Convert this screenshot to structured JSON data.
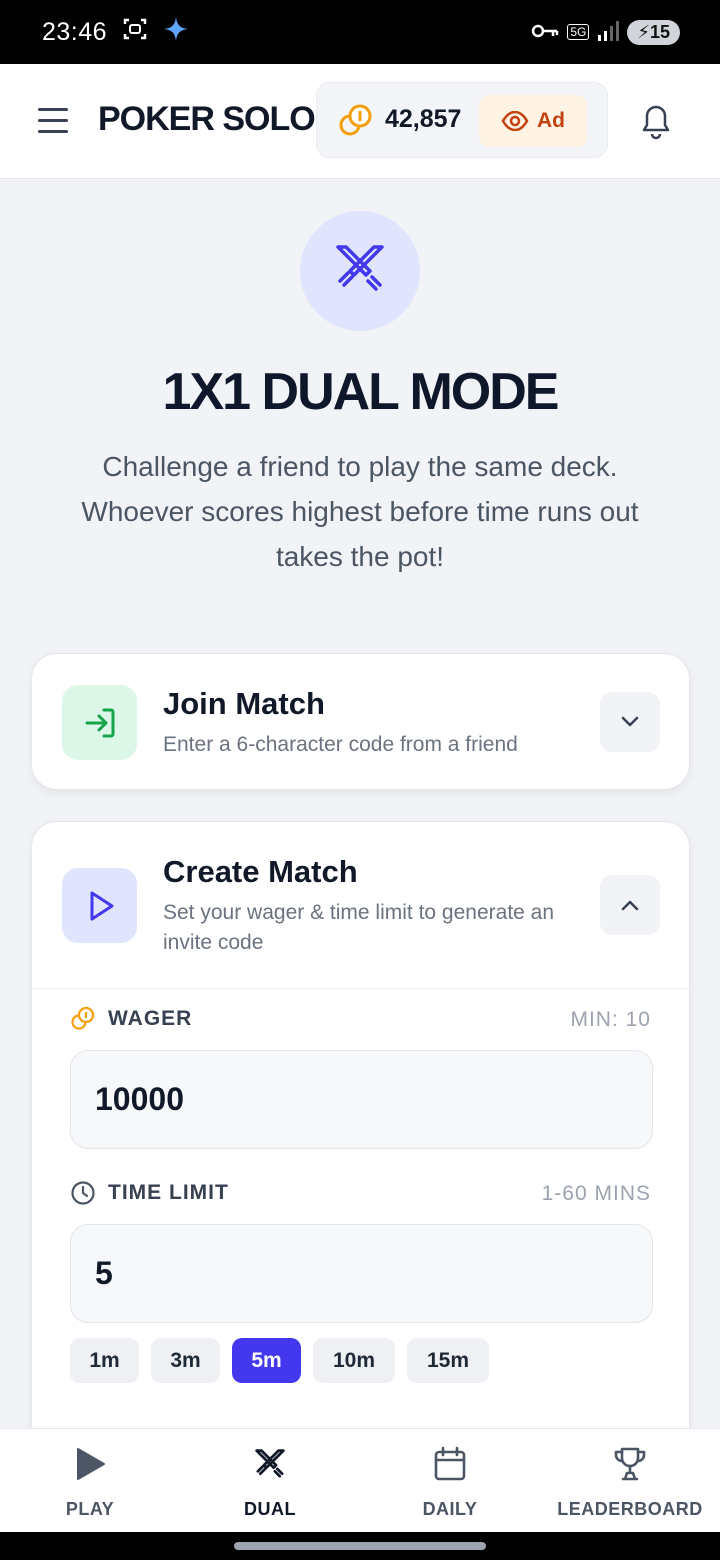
{
  "status_bar": {
    "time": "23:46",
    "network": "5G",
    "battery": "15"
  },
  "header": {
    "title": "POKER SOLO",
    "coins": "42,857",
    "ad_label": "Ad"
  },
  "hero": {
    "title": "1X1 DUAL MODE",
    "description": "Challenge a friend to play the same deck. Whoever scores highest before time runs out takes the pot!"
  },
  "join_match": {
    "title": "Join Match",
    "subtitle": "Enter a 6-character code from a friend"
  },
  "create_match": {
    "title": "Create Match",
    "subtitle": "Set your wager & time limit to generate an invite code",
    "wager": {
      "label": "WAGER",
      "hint": "MIN: 10",
      "value": "10000"
    },
    "time_limit": {
      "label": "TIME LIMIT",
      "hint": "1-60 MINS",
      "value": "5"
    },
    "presets": [
      "1m",
      "3m",
      "5m",
      "10m",
      "15m"
    ],
    "selected_preset": "5m"
  },
  "bottom_nav": {
    "items": [
      {
        "label": "PLAY",
        "icon": "play-icon"
      },
      {
        "label": "DUAL",
        "icon": "crossed-swords-icon"
      },
      {
        "label": "DAILY",
        "icon": "calendar-icon"
      },
      {
        "label": "LEADERBOARD",
        "icon": "trophy-icon"
      }
    ],
    "active": "DUAL"
  },
  "colors": {
    "accent": "#4338ee",
    "coin": "#f59e0b",
    "join_green": "#16a34a",
    "ad_orange": "#c2410c"
  }
}
